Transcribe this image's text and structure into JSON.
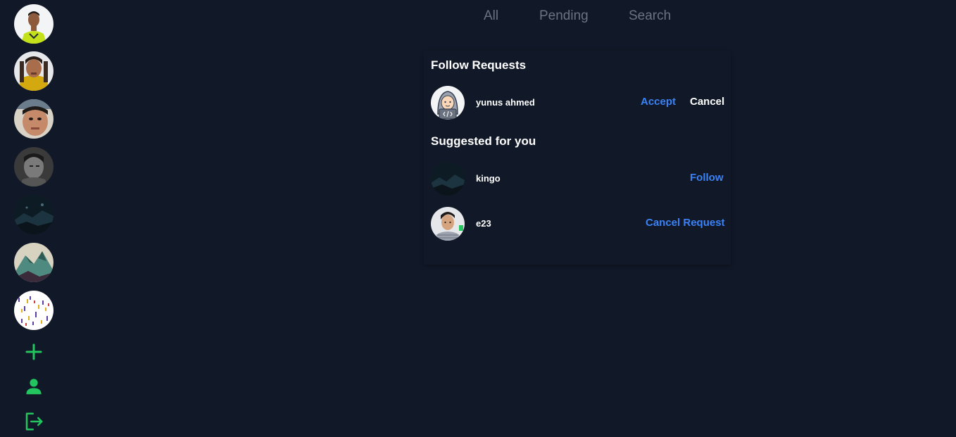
{
  "sidebar": {
    "avatars": [
      {
        "icon": "avatar-man-green-shirt"
      },
      {
        "icon": "avatar-man-yellow-shirt"
      },
      {
        "icon": "avatar-man-selfie"
      },
      {
        "icon": "avatar-grayscale-portrait"
      },
      {
        "icon": "avatar-dark-landscape"
      },
      {
        "icon": "avatar-mountain-art"
      },
      {
        "icon": "avatar-confetti-pattern"
      }
    ],
    "actions": [
      {
        "icon": "plus-icon"
      },
      {
        "icon": "user-icon"
      },
      {
        "icon": "logout-icon"
      }
    ],
    "accent_color": "#22c55e"
  },
  "tabs": [
    {
      "label": "All"
    },
    {
      "label": "Pending"
    },
    {
      "label": "Search"
    }
  ],
  "follow_requests": {
    "title": "Follow Requests",
    "items": [
      {
        "name": "yunus ahmed",
        "accept_label": "Accept",
        "cancel_label": "Cancel"
      }
    ]
  },
  "suggested": {
    "title": "Suggested for you",
    "items": [
      {
        "name": "kingo",
        "action_label": "Follow"
      },
      {
        "name": "e23",
        "action_label": "Cancel Request"
      }
    ]
  },
  "colors": {
    "background": "#111827",
    "link_blue": "#3b82f6",
    "tab_gray": "#6b7280",
    "green": "#22c55e"
  }
}
